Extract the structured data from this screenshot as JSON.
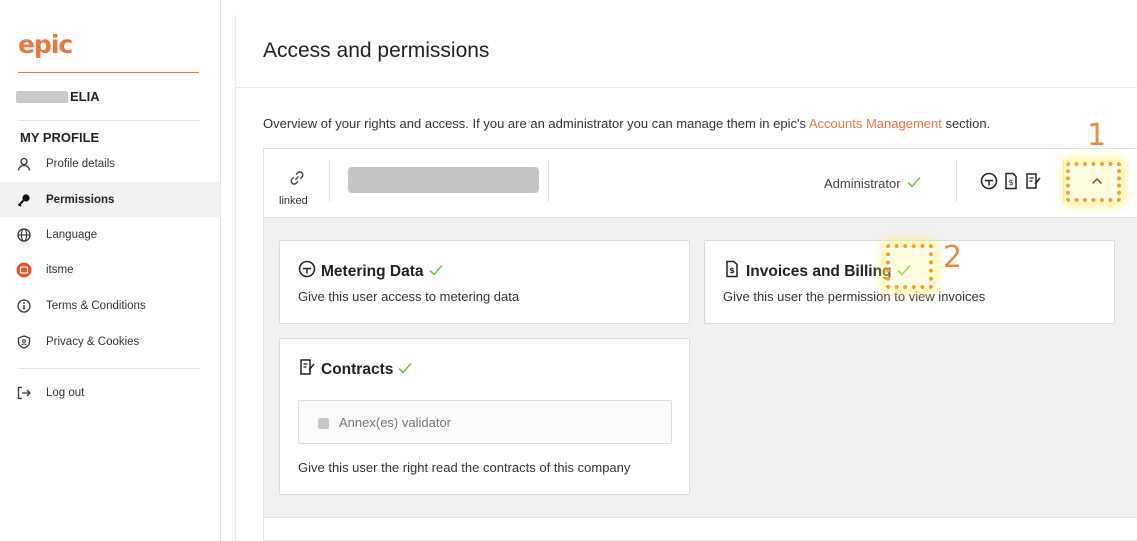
{
  "sidebar": {
    "logo": "epic",
    "user_name": "ELIA",
    "section_title": "MY PROFILE",
    "items": [
      {
        "label": "Profile details"
      },
      {
        "label": "Permissions"
      },
      {
        "label": "Language"
      },
      {
        "label": "itsme"
      },
      {
        "label": "Terms & Conditions"
      },
      {
        "label": "Privacy & Cookies"
      },
      {
        "label": "Log out"
      }
    ]
  },
  "main": {
    "title": "Access and permissions",
    "overview_prefix": "Overview of your rights and access. If you are an administrator you can manage them in epic's ",
    "overview_link": "Accounts Management",
    "overview_suffix": " section.",
    "panel": {
      "linked_label": "linked",
      "role": "Administrator"
    },
    "cards": {
      "metering": {
        "title": "Metering Data",
        "desc": "Give this user access to metering data"
      },
      "invoices": {
        "title": "Invoices and Billing",
        "desc": "Give this user the permission to view invoices"
      },
      "contracts": {
        "title": "Contracts",
        "checkbox_label": "Annex(es) validator",
        "desc": "Give this user the right read the contracts of this company"
      }
    }
  },
  "annotations": {
    "first": "1",
    "second": "2"
  },
  "colors": {
    "accent": "#e8763f",
    "check": "#7cc242"
  }
}
